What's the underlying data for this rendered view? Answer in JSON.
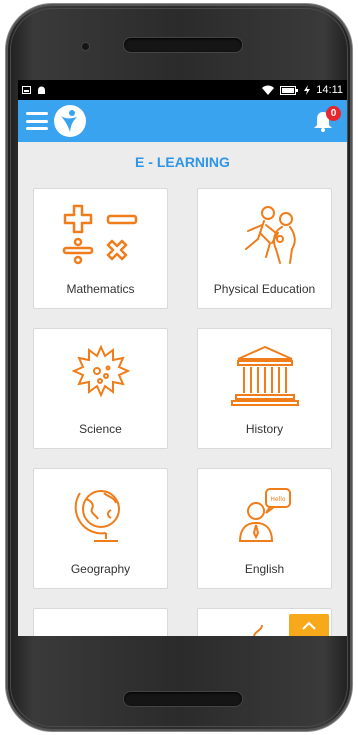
{
  "statusbar": {
    "left_icons": [
      "gallery-icon",
      "android-icon"
    ],
    "time": "14:11",
    "right_icons": [
      "wifi-icon",
      "battery-icon",
      "charging-icon"
    ]
  },
  "appbar": {
    "menu_icon": "hamburger-menu-icon",
    "logo_icon": "app-logo-icon",
    "notification_icon": "bell-icon",
    "notification_count": "0",
    "background": "#3aa3f0"
  },
  "section": {
    "title": "E - LEARNING",
    "accent": "#2e96e8"
  },
  "subjects": [
    {
      "label": "Mathematics",
      "icon": "math-operators-icon"
    },
    {
      "label": "Physical Education",
      "icon": "athletes-icon"
    },
    {
      "label": "Science",
      "icon": "sun-cell-icon"
    },
    {
      "label": "History",
      "icon": "temple-icon"
    },
    {
      "label": "Geography",
      "icon": "globe-icon"
    },
    {
      "label": "English",
      "icon": "speech-hello-icon"
    },
    {
      "label": "",
      "icon": "hindi-letter-icon"
    },
    {
      "label": "",
      "icon": "computer-mouse-icon"
    }
  ],
  "icon_color": "#f07d1a",
  "scroll_top_icon": "chevron-up-icon",
  "scroll_top_color": "#f7a81b"
}
